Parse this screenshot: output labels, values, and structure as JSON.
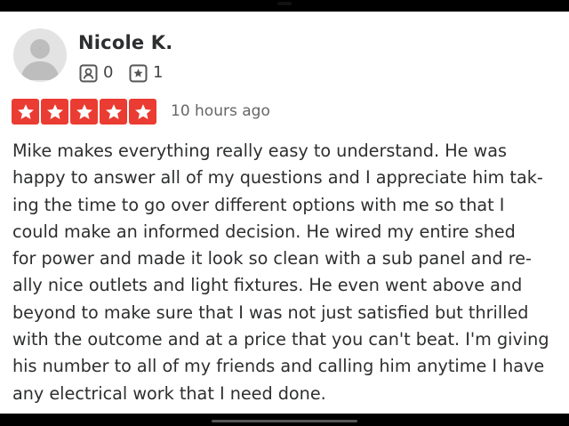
{
  "reviewer": {
    "name": "Nicole K.",
    "friends_count": "0",
    "reviews_count": "1"
  },
  "rating": {
    "stars": 5,
    "max_stars": 5,
    "star_color": "#ea3c32",
    "time_ago": "10 hours ago"
  },
  "review": {
    "lines": [
      "Mike makes everything really easy to understand. He was",
      "happy to answer all of my questions and I appreciate him tak-",
      "ing the time to go over different options with me so that I",
      "could make an informed decision. He wired my entire shed",
      "for power and made it look so clean with a sub panel and re-",
      "ally nice outlets and light fixtures. He even went above and",
      "beyond to make sure that I was not just satisfied but thrilled",
      "with the outcome and at a price that you can't beat. I'm giving",
      "his number to all of my friends and calling him anytime I have",
      "any electrical work that I need done."
    ]
  },
  "icons": {
    "avatar": "default-avatar-icon",
    "friends": "friends-icon",
    "reviews": "review-star-icon",
    "rating": "star-icon"
  }
}
